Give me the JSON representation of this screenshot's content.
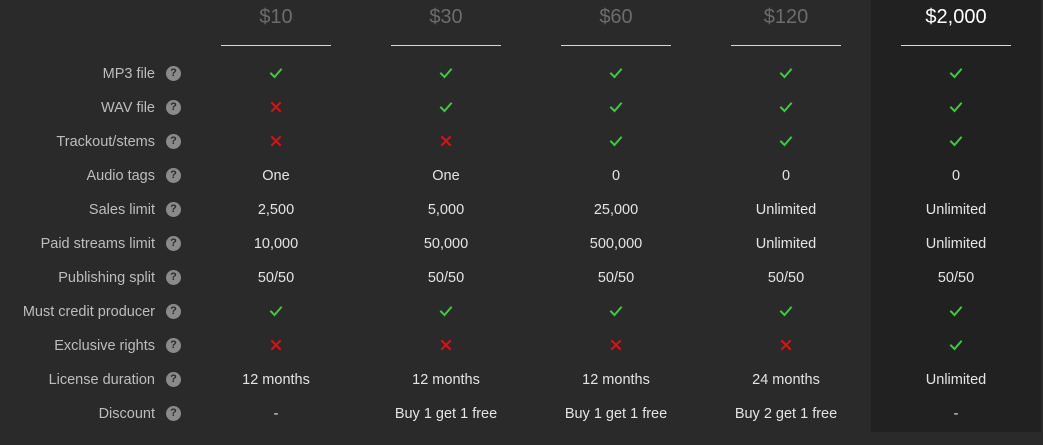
{
  "colors": {
    "background": "#2a2a2a",
    "highlight_column": "#212121",
    "check": "#2fd52f",
    "cross": "#e01010",
    "price_inactive": "#6c6c6c",
    "price_active": "#ffffff"
  },
  "tiers": [
    {
      "price": "$10",
      "selected": false
    },
    {
      "price": "$30",
      "selected": false
    },
    {
      "price": "$60",
      "selected": false
    },
    {
      "price": "$120",
      "selected": false
    },
    {
      "price": "$2,000",
      "selected": true
    }
  ],
  "rows": [
    {
      "label": "MP3 file",
      "values": [
        {
          "icon": "check-icon"
        },
        {
          "icon": "check-icon"
        },
        {
          "icon": "check-icon"
        },
        {
          "icon": "check-icon"
        },
        {
          "icon": "check-icon"
        }
      ]
    },
    {
      "label": "WAV file",
      "values": [
        {
          "icon": "cross-icon"
        },
        {
          "icon": "check-icon"
        },
        {
          "icon": "check-icon"
        },
        {
          "icon": "check-icon"
        },
        {
          "icon": "check-icon"
        }
      ]
    },
    {
      "label": "Trackout/stems",
      "values": [
        {
          "icon": "cross-icon"
        },
        {
          "icon": "cross-icon"
        },
        {
          "icon": "check-icon"
        },
        {
          "icon": "check-icon"
        },
        {
          "icon": "check-icon"
        }
      ]
    },
    {
      "label": "Audio tags",
      "values": [
        {
          "text": "One"
        },
        {
          "text": "One"
        },
        {
          "text": "0"
        },
        {
          "text": "0"
        },
        {
          "text": "0"
        }
      ]
    },
    {
      "label": "Sales limit",
      "values": [
        {
          "text": "2,500"
        },
        {
          "text": "5,000"
        },
        {
          "text": "25,000"
        },
        {
          "text": "Unlimited"
        },
        {
          "text": "Unlimited"
        }
      ]
    },
    {
      "label": "Paid streams limit",
      "values": [
        {
          "text": "10,000"
        },
        {
          "text": "50,000"
        },
        {
          "text": "500,000"
        },
        {
          "text": "Unlimited"
        },
        {
          "text": "Unlimited"
        }
      ]
    },
    {
      "label": "Publishing split",
      "values": [
        {
          "text": "50/50"
        },
        {
          "text": "50/50"
        },
        {
          "text": "50/50"
        },
        {
          "text": "50/50"
        },
        {
          "text": "50/50"
        }
      ]
    },
    {
      "label": "Must credit producer",
      "values": [
        {
          "icon": "check-icon"
        },
        {
          "icon": "check-icon"
        },
        {
          "icon": "check-icon"
        },
        {
          "icon": "check-icon"
        },
        {
          "icon": "check-icon"
        }
      ]
    },
    {
      "label": "Exclusive rights",
      "values": [
        {
          "icon": "cross-icon"
        },
        {
          "icon": "cross-icon"
        },
        {
          "icon": "cross-icon"
        },
        {
          "icon": "cross-icon"
        },
        {
          "icon": "check-icon"
        }
      ]
    },
    {
      "label": "License duration",
      "values": [
        {
          "text": "12 months"
        },
        {
          "text": "12 months"
        },
        {
          "text": "12 months"
        },
        {
          "text": "24 months"
        },
        {
          "text": "Unlimited"
        }
      ]
    },
    {
      "label": "Discount",
      "values": [
        {
          "text": "-"
        },
        {
          "text": "Buy 1 get 1 free"
        },
        {
          "text": "Buy 1 get 1 free"
        },
        {
          "text": "Buy 2 get 1 free"
        },
        {
          "text": "-"
        }
      ]
    }
  ],
  "help_glyph": "?"
}
